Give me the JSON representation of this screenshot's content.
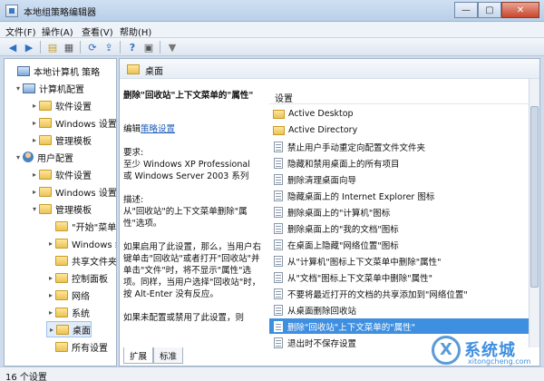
{
  "window": {
    "title": "本地组策略编辑器"
  },
  "menu": [
    "文件(F)",
    "操作(A)",
    "查看(V)",
    "帮助(H)"
  ],
  "tree": [
    {
      "label": "本地计算机 策略",
      "level": 0,
      "icon": "computer-icon",
      "arrow": ""
    },
    {
      "label": "计算机配置",
      "level": 1,
      "icon": "computer-icon",
      "arrow": "▾"
    },
    {
      "label": "软件设置",
      "level": 2,
      "icon": "folder-icon",
      "arrow": "▸"
    },
    {
      "label": "Windows 设置",
      "level": 2,
      "icon": "folder-icon",
      "arrow": "▸"
    },
    {
      "label": "管理模板",
      "level": 2,
      "icon": "folder-icon",
      "arrow": "▸"
    },
    {
      "label": "用户配置",
      "level": 1,
      "icon": "user-icon",
      "arrow": "▾"
    },
    {
      "label": "软件设置",
      "level": 2,
      "icon": "folder-icon",
      "arrow": "▸"
    },
    {
      "label": "Windows 设置",
      "level": 2,
      "icon": "folder-icon",
      "arrow": "▸"
    },
    {
      "label": "管理模板",
      "level": 2,
      "icon": "folder-icon",
      "arrow": "▾"
    },
    {
      "label": "\"开始\"菜单",
      "level": 3,
      "icon": "folder-icon",
      "arrow": ""
    },
    {
      "label": "Windows 组件",
      "level": 3,
      "icon": "folder-icon",
      "arrow": "▸"
    },
    {
      "label": "共享文件夹",
      "level": 3,
      "icon": "folder-icon",
      "arrow": ""
    },
    {
      "label": "控制面板",
      "level": 3,
      "icon": "folder-icon",
      "arrow": "▸"
    },
    {
      "label": "网络",
      "level": 3,
      "icon": "folder-icon",
      "arrow": "▸"
    },
    {
      "label": "系统",
      "level": 3,
      "icon": "folder-icon",
      "arrow": "▸"
    },
    {
      "label": "桌面",
      "level": 3,
      "icon": "folder-icon",
      "arrow": "▸",
      "selected": true
    },
    {
      "label": "所有设置",
      "level": 3,
      "icon": "folder-icon",
      "arrow": ""
    }
  ],
  "right": {
    "header": "桌面",
    "desc": {
      "heading": "删除\"回收站\"上下文菜单的\"属性\"",
      "edit_prefix": "编辑",
      "edit_link": "策略设置",
      "req_label": "要求:",
      "req_text": "至少 Windows XP Professional 或 Windows Server 2003 系列",
      "desc_label": "描述:",
      "desc_text": "从\"回收站\"的上下文菜单删除\"属性\"选项。",
      "p1": "如果启用了此设置，那么，当用户右键单击\"回收站\"或者打开\"回收站\"并单击\"文件\"时，将不显示\"属性\"选项。同样，当用户选择\"回收站\"时，按 Alt-Enter 没有反应。",
      "p2": "如果未配置或禁用了此设置，则"
    },
    "list_header": "设置",
    "items": [
      {
        "label": "Active Desktop",
        "icon": "folder-icon"
      },
      {
        "label": "Active Directory",
        "icon": "folder-icon"
      },
      {
        "label": "禁止用户手动重定向配置文件文件夹",
        "icon": "policy-icon"
      },
      {
        "label": "隐藏和禁用桌面上的所有项目",
        "icon": "policy-icon"
      },
      {
        "label": "删除清理桌面向导",
        "icon": "policy-icon"
      },
      {
        "label": "隐藏桌面上的 Internet Explorer 图标",
        "icon": "policy-icon"
      },
      {
        "label": "删除桌面上的\"计算机\"图标",
        "icon": "policy-icon"
      },
      {
        "label": "删除桌面上的\"我的文档\"图标",
        "icon": "policy-icon"
      },
      {
        "label": "在桌面上隐藏\"网络位置\"图标",
        "icon": "policy-icon"
      },
      {
        "label": "从\"计算机\"图标上下文菜单中删除\"属性\"",
        "icon": "policy-icon"
      },
      {
        "label": "从\"文档\"图标上下文菜单中删除\"属性\"",
        "icon": "policy-icon"
      },
      {
        "label": "不要将最近打开的文档的共享添加到\"网络位置\"",
        "icon": "policy-icon"
      },
      {
        "label": "从桌面删除回收站",
        "icon": "policy-icon"
      },
      {
        "label": "删除\"回收站\"上下文菜单的\"属性\"",
        "icon": "policy-icon",
        "selected": true
      },
      {
        "label": "退出时不保存设置",
        "icon": "policy-icon"
      }
    ],
    "tabs": [
      "扩展",
      "标准"
    ]
  },
  "status": "16 个设置",
  "watermark": {
    "title": "系统城",
    "url": "xitongcheng.com"
  }
}
